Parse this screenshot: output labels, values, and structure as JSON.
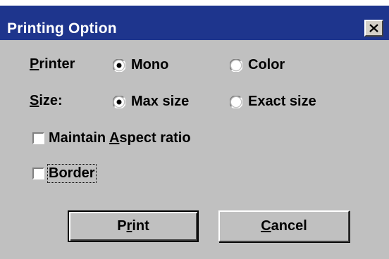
{
  "window": {
    "title": "Printing Option"
  },
  "printer": {
    "label_u": "P",
    "label_rest": "rinter",
    "options": [
      {
        "label": "Mono",
        "selected": true
      },
      {
        "label": "Color",
        "selected": false
      }
    ]
  },
  "size": {
    "label_u": "S",
    "label_rest": "ize:",
    "options": [
      {
        "label": "Max size",
        "selected": true
      },
      {
        "label": "Exact size",
        "selected": false
      }
    ]
  },
  "checkboxes": {
    "aspect": {
      "pre": "Maintain ",
      "u": "A",
      "post": "spect ratio",
      "checked": false
    },
    "border": {
      "label": "Border",
      "checked": false
    }
  },
  "buttons": {
    "print": {
      "pre": "P",
      "u": "r",
      "post": "int"
    },
    "cancel": {
      "u": "C",
      "post": "ancel"
    }
  },
  "colors": {
    "titlebar": "#1e358d",
    "dialog_bg": "#c0c0c0"
  }
}
